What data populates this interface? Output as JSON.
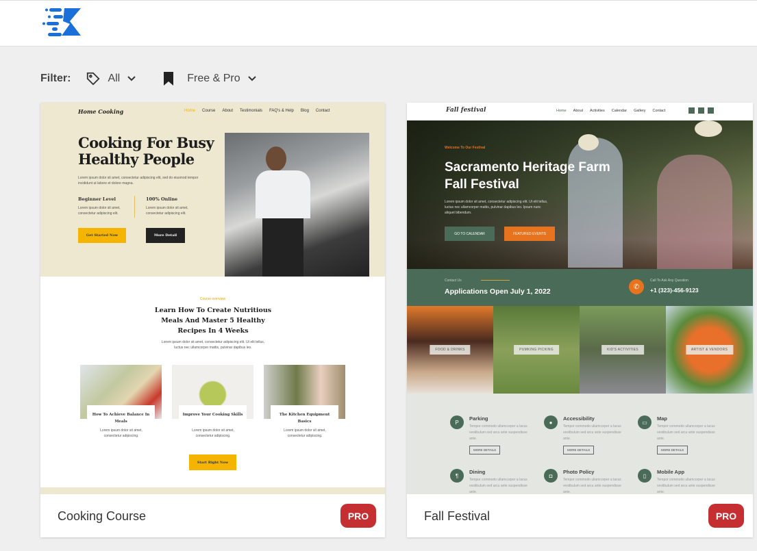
{
  "header": {
    "logo": "K"
  },
  "filter": {
    "label": "Filter:",
    "category": "All",
    "type": "Free & Pro"
  },
  "colors": {
    "pro_badge": "#c62f32",
    "cooking_beige": "#ede8cf",
    "cooking_accent": "#f5b400",
    "festival_green": "#4a6b57",
    "festival_orange": "#e8731e"
  },
  "cards": [
    {
      "title": "Cooking Course",
      "badge": "PRO",
      "preview": {
        "brand": "Home Cooking",
        "nav": [
          "Home",
          "Course",
          "About",
          "Testimonials",
          "FAQ's & Help",
          "Blog",
          "Contact"
        ],
        "hero_title": "Cooking For Busy Healthy People",
        "hero_text": "Lorem ipsum dolor sit amet, consectetur adipiscing elit, sed do eiusmod tempor incididunt ut labore et dolore magna.",
        "features": [
          {
            "title": "Beginner Level",
            "text": "Lorem ipsum dolor sit amet, consectetur adipiscing elit."
          },
          {
            "title": "100% Online",
            "text": "Lorem ipsum dolor sit amet, consectetur adipiscing elit."
          }
        ],
        "btn_primary": "Get Started Now",
        "btn_secondary": "More Detail",
        "overview_label": "Course overview",
        "overview_title": "Learn How To Create Nutritious Meals And Master 5 Healthy Recipes In 4 Weeks",
        "overview_text": "Lorem ipsum dolor sit amet, consectetur adipiscing elit. Ut elit tellus, luctus nec ullamcorper mattis, pulvinar dapibus leo.",
        "lessons": [
          {
            "title": "How To Achieve Balance In Meals",
            "text": "Lorem ipsum dolor sit amet, consectetur adipiscing."
          },
          {
            "title": "Improve Your Cooking Skills",
            "text": "Lorem ipsum dolor sit amet, consectetur adipiscing."
          },
          {
            "title": "The Kitchen Equipment Basics",
            "text": "Lorem ipsum dolor sit amet, consectetur adipiscing."
          }
        ],
        "cta": "Start Right Now"
      }
    },
    {
      "title": "Fall Festival",
      "badge": "PRO",
      "preview": {
        "brand": "Fall festival",
        "nav": [
          "Home",
          "About",
          "Activities",
          "Calendar",
          "Gallery",
          "Contact"
        ],
        "kicker": "Welcome To Our Festival",
        "hero_title": "Sacramento Heritage Farm Fall Festival",
        "hero_text": "Lorem ipsum dolor sit amet, consectetur adipiscing elit. Ut elit tellus, luctus nec ullamcorper mattis, pulvinar dapibus leo. Ipsum nunc aliquet bibendum.",
        "btn_primary": "GO TO CALENDAR",
        "btn_secondary": "FEATURED EVENTS",
        "contact_label": "Contact Us",
        "contact_title": "Applications Open July 1, 2022",
        "call_label": "Call To Ask Any Question",
        "phone": "+1 (323)-456-9123",
        "activities": [
          "FOOD & DRINKS",
          "PUMKING PICKING",
          "KID'S ACTIVITIES",
          "ARTIST & VENDORS"
        ],
        "info": [
          {
            "title": "Parking",
            "icon": "P"
          },
          {
            "title": "Accessibility",
            "icon": "●"
          },
          {
            "title": "Map",
            "icon": "▭"
          },
          {
            "title": "Dining",
            "icon": "¶"
          },
          {
            "title": "Photo Policy",
            "icon": "◘"
          },
          {
            "title": "Mobile App",
            "icon": "▯"
          }
        ],
        "info_text": "Tempor commodo ullamcorper a lacus vestibulum sed arcu ante suspendisse ante.",
        "more": "MORE DETAILS"
      }
    }
  ]
}
